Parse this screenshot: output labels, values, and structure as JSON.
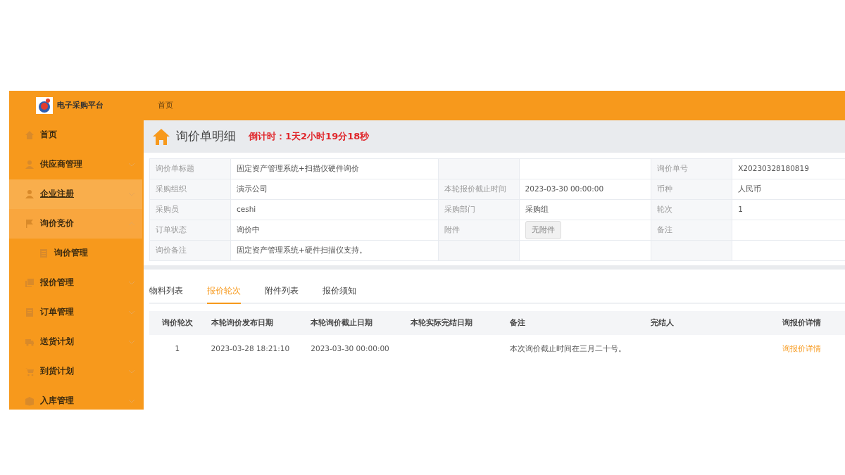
{
  "header": {
    "logo_text": "电子采购平台",
    "breadcrumb": "首页"
  },
  "sidebar": {
    "items": [
      {
        "kind": "link",
        "label": "首页",
        "selected": false
      },
      {
        "kind": "group",
        "label": "供应商管理",
        "selected": false,
        "expanded": false
      },
      {
        "kind": "group",
        "label": "企业注册",
        "selected": true,
        "expanded": false
      },
      {
        "kind": "group",
        "label": "询价竞价",
        "selected": false,
        "expanded": true,
        "children": [
          {
            "label": "询价管理",
            "selected": false
          }
        ]
      },
      {
        "kind": "group",
        "label": "报价管理",
        "selected": false,
        "expanded": false
      },
      {
        "kind": "group",
        "label": "订单管理",
        "selected": false,
        "expanded": false
      },
      {
        "kind": "group",
        "label": "送货计划",
        "selected": false,
        "expanded": false
      },
      {
        "kind": "group",
        "label": "到货计划",
        "selected": false,
        "expanded": false
      },
      {
        "kind": "group",
        "label": "入库管理",
        "selected": false,
        "expanded": false
      }
    ]
  },
  "page": {
    "title": "询价单明细",
    "countdown": "倒计时：1天2小时19分18秒"
  },
  "info_table": {
    "rows": [
      [
        "询价单标题",
        "固定资产管理系统+扫描仪硬件询价",
        "",
        "",
        "询价单号",
        "X20230328180819"
      ],
      [
        "采购组织",
        "演示公司",
        "本轮报价截止时间",
        "2023-03-30 00:00:00",
        "币种",
        "人民币"
      ],
      [
        "采购员",
        "ceshi",
        "采购部门",
        "采购组",
        "轮次",
        "1"
      ],
      [
        "订单状态",
        "询价中",
        "附件",
        {
          "button": "无附件"
        },
        "备注",
        ""
      ],
      [
        "询价备注",
        "固定资产管理系统+硬件扫描仪支持。",
        "",
        "",
        "",
        ""
      ]
    ]
  },
  "tabs": [
    {
      "label": "物料列表",
      "selected": false
    },
    {
      "label": "报价轮次",
      "selected": true
    },
    {
      "label": "附件列表",
      "selected": false
    },
    {
      "label": "报价须知",
      "selected": false
    }
  ],
  "rounds_table": {
    "columns": [
      "询价轮次",
      "本轮询价发布日期",
      "本轮询价截止日期",
      "本轮实际完结日期",
      "备注",
      "完结人",
      "询报价详情"
    ],
    "rows": [
      {
        "cells": [
          "1",
          "2023-03-28 18:21:10",
          "2023-03-30 00:00:00",
          "",
          "本次询价截止时间在三月二十号。",
          ""
        ],
        "link": "询报价详情"
      }
    ]
  }
}
